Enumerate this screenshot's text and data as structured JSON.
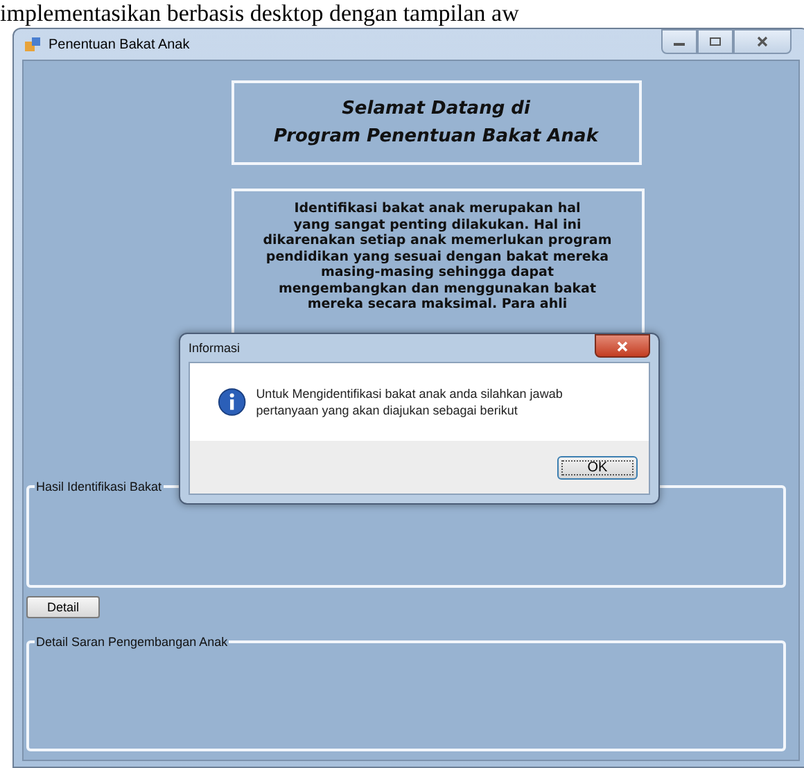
{
  "document_text": "implementasikan berbasis desktop dengan tampilan aw",
  "window": {
    "title": "Penentuan Bakat Anak"
  },
  "welcome": {
    "lines": [
      "Selamat Datang di",
      "Program Penentuan Bakat Anak"
    ]
  },
  "intro": {
    "lines": [
      "Identifikasi bakat anak merupakan hal",
      "yang sangat penting dilakukan. Hal ini",
      "dikarenakan setiap anak memerlukan program",
      "pendidikan yang sesuai dengan bakat mereka",
      "masing-masing sehingga dapat",
      "mengembangkan dan menggunakan bakat",
      "mereka secara maksimal. Para ahli"
    ]
  },
  "groups": [
    {
      "title": "Hasil Identifikasi Bakat"
    },
    {
      "title": "Detail Saran Pengembangan Anak"
    }
  ],
  "detail_button": "Detail",
  "dialog": {
    "title": "Informasi",
    "message": "Untuk Mengidentifikasi bakat anak anda silahkan jawab pertanyaan yang akan diajukan sebagai berikut",
    "button": "OK"
  }
}
